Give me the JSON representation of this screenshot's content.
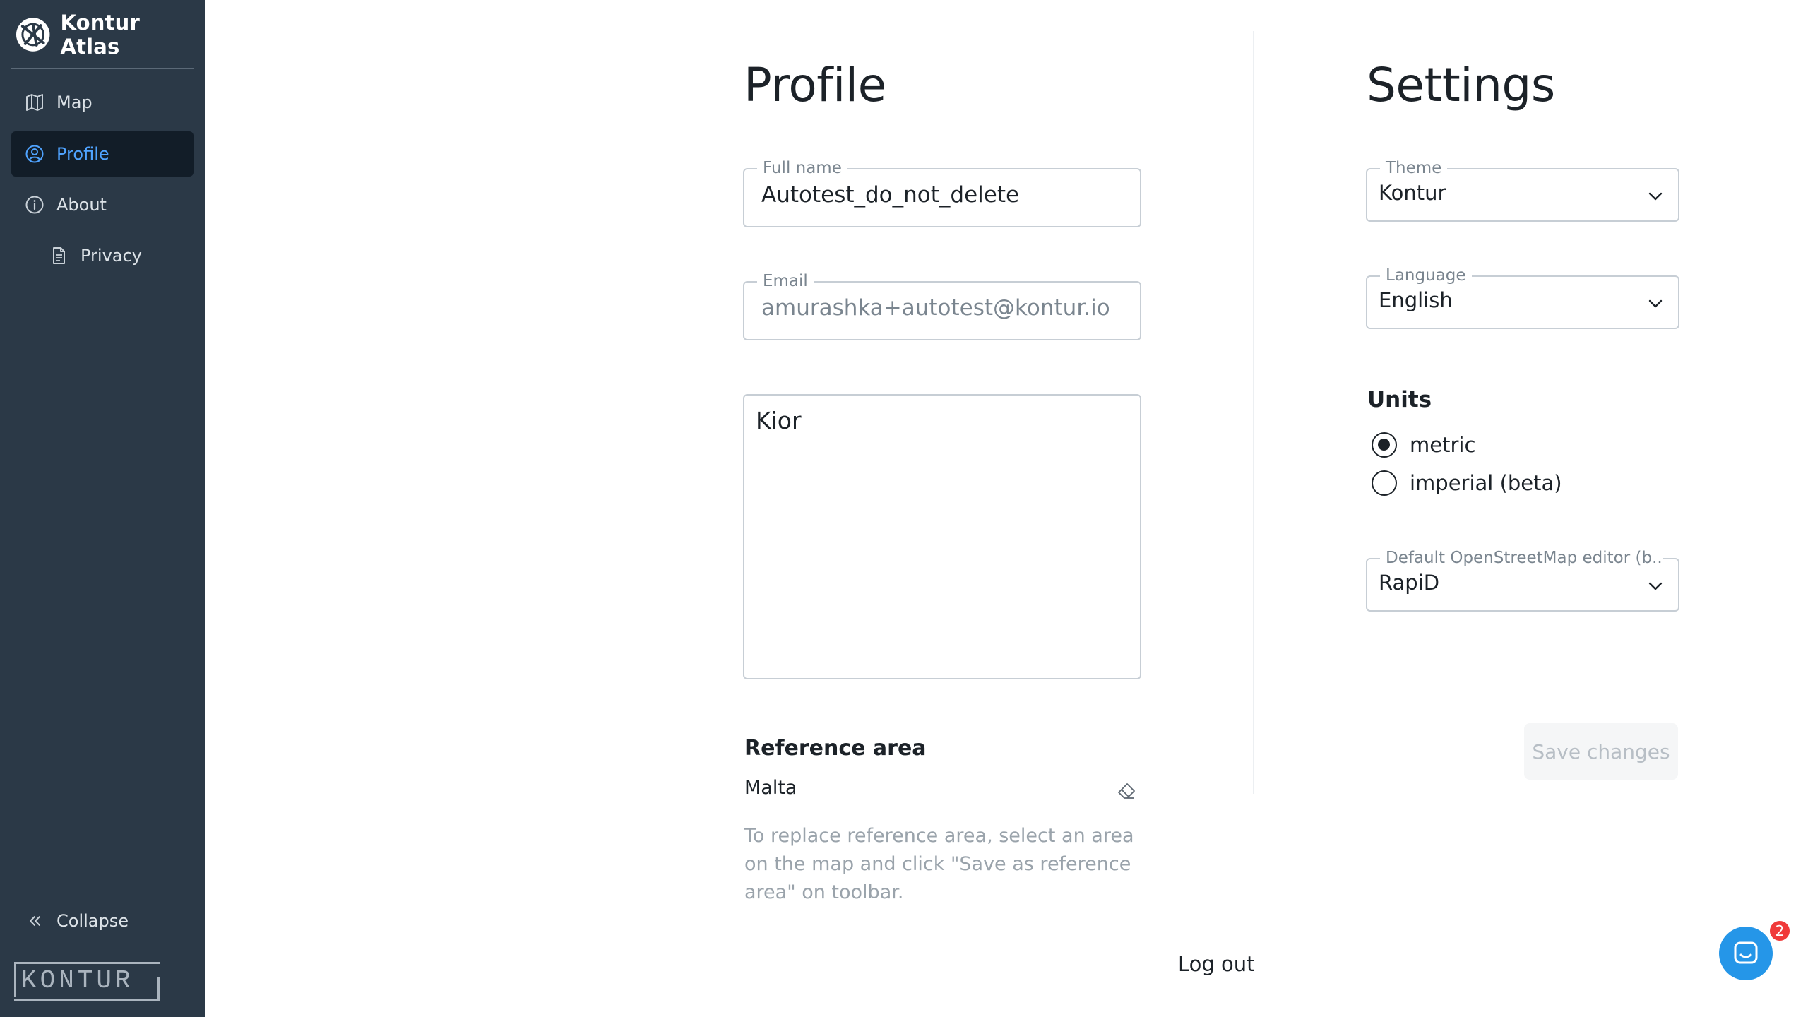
{
  "app": {
    "title": "Kontur Atlas"
  },
  "sidebar": {
    "items": [
      {
        "label": "Map",
        "icon": "map-icon"
      },
      {
        "label": "Profile",
        "icon": "user-circle-icon",
        "active": true
      },
      {
        "label": "About",
        "icon": "info-icon"
      },
      {
        "label": "Privacy",
        "icon": "document-icon"
      }
    ],
    "collapse_label": "Collapse",
    "footer_logo": "KONTUR"
  },
  "profile": {
    "title": "Profile",
    "full_name": {
      "label": "Full name",
      "value": "Autotest_do_not_delete"
    },
    "email": {
      "label": "Email",
      "value": "amurashka+autotest@kontur.io"
    },
    "bio": {
      "value": "Kior"
    },
    "reference_area": {
      "title": "Reference area",
      "value": "Malta",
      "hint": "To replace reference area, select an area on the map and click \"Save as reference area\" on toolbar."
    },
    "logout_label": "Log out"
  },
  "settings": {
    "title": "Settings",
    "theme": {
      "label": "Theme",
      "value": "Kontur"
    },
    "language": {
      "label": "Language",
      "value": "English"
    },
    "units": {
      "title": "Units",
      "options": [
        {
          "label": "metric",
          "checked": true
        },
        {
          "label": "imperial (beta)",
          "checked": false
        }
      ]
    },
    "osm_editor": {
      "label": "Default OpenStreetMap editor (b...",
      "value": "RapiD"
    },
    "save_label": "Save changes"
  },
  "chat": {
    "badge_count": "2"
  },
  "colors": {
    "sidebar_bg": "#2b3947",
    "active_bg": "#121d28",
    "accent": "#4fa3ff",
    "chat_button": "#2596e8",
    "badge": "#f03a3a"
  }
}
